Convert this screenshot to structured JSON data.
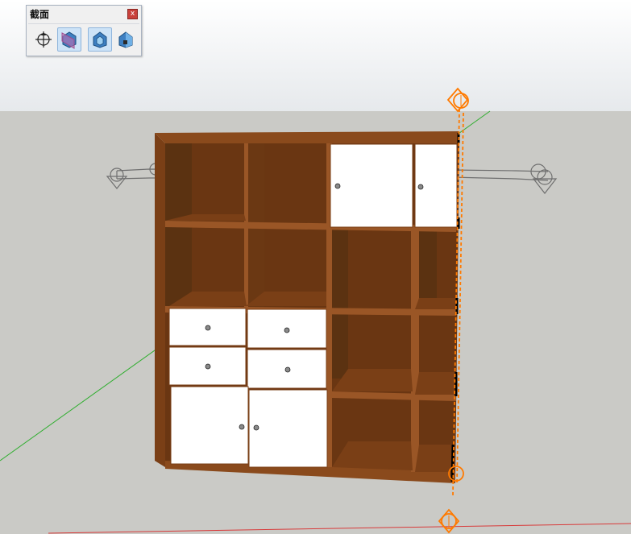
{
  "toolbar": {
    "title": "截面",
    "close_glyph": "x",
    "tools": [
      {
        "name": "add-section-plane-icon",
        "active": false
      },
      {
        "name": "display-section-planes-icon",
        "active": true
      },
      {
        "name": "display-section-cuts-icon",
        "active": true
      },
      {
        "name": "display-section-fill-icon",
        "active": false
      }
    ]
  },
  "colors": {
    "sky_top": "#ffffff",
    "sky_bottom": "#e6e9ec",
    "ground": "#cacac6",
    "wood": "#8a4a1c",
    "wood_dark": "#5b3211",
    "door": "#ffffff",
    "section_plane_active": "#ff7a00",
    "section_plane_inactive": "#6f6f6f",
    "axis_green": "#2fae2f",
    "axis_red": "#d83a3a"
  }
}
